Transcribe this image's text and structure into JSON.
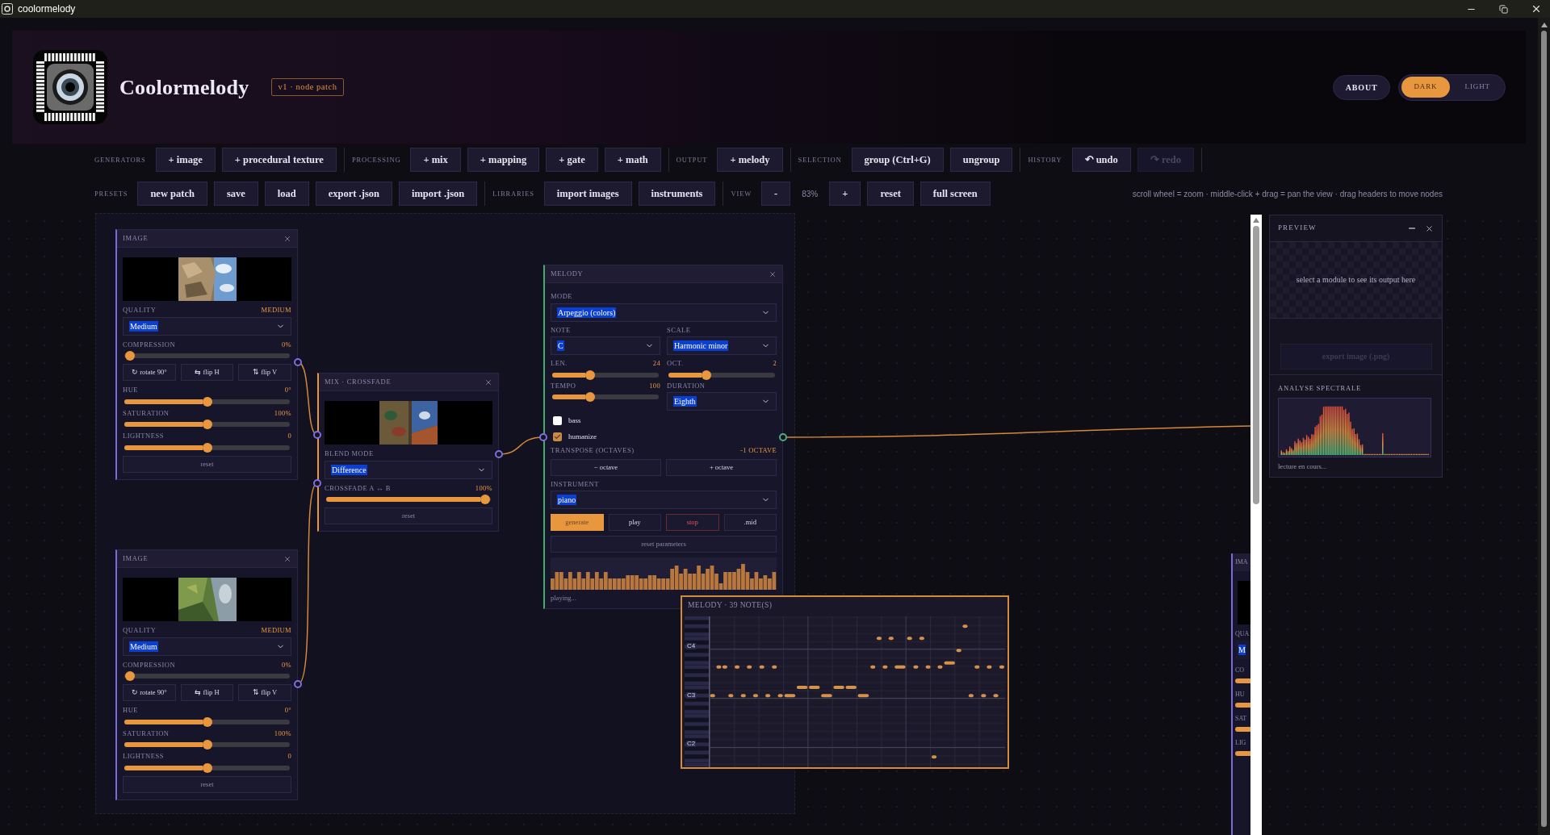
{
  "window": {
    "title": "coolormelody"
  },
  "header": {
    "title": "Coolormelody",
    "badge": "v1 · node patch",
    "about": "ABOUT",
    "theme": [
      {
        "label": "DARK",
        "selected": true
      },
      {
        "label": "LIGHT",
        "selected": false
      }
    ]
  },
  "toolbar": [
    {
      "groups": [
        {
          "label": "GENERATORS",
          "items": [
            {
              "kind": "button",
              "label": "+ image"
            },
            {
              "kind": "button",
              "label": "+ procedural texture"
            }
          ]
        },
        {
          "label": "PROCESSING",
          "items": [
            {
              "kind": "button",
              "label": "+ mix"
            },
            {
              "kind": "button",
              "label": "+ mapping"
            },
            {
              "kind": "button",
              "label": "+ gate"
            },
            {
              "kind": "button",
              "label": "+ math"
            }
          ]
        },
        {
          "label": "OUTPUT",
          "items": [
            {
              "kind": "button",
              "label": "+ melody"
            }
          ]
        },
        {
          "label": "SELECTION",
          "items": [
            {
              "kind": "button",
              "label": "group (Ctrl+G)"
            },
            {
              "kind": "button",
              "label": "ungroup"
            }
          ]
        },
        {
          "label": "HISTORY",
          "items": [
            {
              "kind": "button",
              "label": "↶ undo",
              "disabled": false
            },
            {
              "kind": "button",
              "label": "↷ redo",
              "disabled": true
            }
          ]
        }
      ]
    },
    {
      "groups": [
        {
          "label": "PRESETS",
          "items": [
            {
              "kind": "button",
              "label": "new patch"
            },
            {
              "kind": "button",
              "label": "save"
            },
            {
              "kind": "button",
              "label": "load"
            },
            {
              "kind": "button",
              "label": "export .json"
            },
            {
              "kind": "button",
              "label": "import .json"
            }
          ]
        },
        {
          "label": "LIBRARIES",
          "items": [
            {
              "kind": "button",
              "label": "import images"
            },
            {
              "kind": "button",
              "label": "instruments"
            }
          ]
        },
        {
          "label": "VIEW",
          "items": [
            {
              "kind": "button",
              "label": "-"
            },
            {
              "kind": "reading",
              "label": "83%"
            },
            {
              "kind": "button",
              "label": "+"
            },
            {
              "kind": "button",
              "label": "reset"
            },
            {
              "kind": "button",
              "label": "full screen"
            }
          ]
        }
      ],
      "hint": "scroll wheel = zoom · middle-click + drag = pan the view · drag headers to move nodes"
    }
  ],
  "canvas": {
    "image_nodes": [
      {
        "title": "IMAGE",
        "controls": [
          {
            "kind": "preview"
          },
          {
            "kind": "select",
            "label": "QUALITY",
            "reading": "MEDIUM",
            "value": "Medium"
          },
          {
            "kind": "slider",
            "label": "COMPRESSION",
            "reading": "0%",
            "level": 0
          },
          {
            "kind": "buttons",
            "items": [
              {
                "label": "↻ rotate 90°",
                "kind": "plain"
              },
              {
                "label": "⇆ flip H",
                "kind": "plain"
              },
              {
                "label": "⇅ flip V",
                "kind": "plain"
              }
            ]
          },
          {
            "kind": "slider",
            "label": "HUE",
            "reading": "0°",
            "level": 0.5
          },
          {
            "kind": "slider",
            "label": "SATURATION",
            "reading": "100%",
            "level": 0.5
          },
          {
            "kind": "slider",
            "label": "LIGHTNESS",
            "reading": "0",
            "level": 0.5
          },
          {
            "kind": "button",
            "label": "reset"
          }
        ]
      },
      {
        "title": "IMAGE",
        "controls": [
          {
            "kind": "preview"
          },
          {
            "kind": "select",
            "label": "QUALITY",
            "reading": "MEDIUM",
            "value": "Medium"
          },
          {
            "kind": "slider",
            "label": "COMPRESSION",
            "reading": "0%",
            "level": 0
          },
          {
            "kind": "buttons",
            "items": [
              {
                "label": "↻ rotate 90°",
                "kind": "plain"
              },
              {
                "label": "⇆ flip H",
                "kind": "plain"
              },
              {
                "label": "⇅ flip V",
                "kind": "plain"
              }
            ]
          },
          {
            "kind": "slider",
            "label": "HUE",
            "reading": "0°",
            "level": 0.5
          },
          {
            "kind": "slider",
            "label": "SATURATION",
            "reading": "100%",
            "level": 0.5
          },
          {
            "kind": "slider",
            "label": "LIGHTNESS",
            "reading": "0",
            "level": 0.5
          },
          {
            "kind": "button",
            "label": "reset"
          }
        ]
      }
    ],
    "mix_node": {
      "title": "MIX · CROSSFADE",
      "controls": [
        {
          "kind": "preview"
        },
        {
          "kind": "select",
          "label": "BLEND MODE",
          "value": "Difference"
        },
        {
          "kind": "slider",
          "label": "CROSSFADE A ↔ B",
          "reading": "100%",
          "level": 1
        },
        {
          "kind": "button",
          "label": "reset"
        }
      ]
    },
    "melody_node": {
      "title": "MELODY",
      "controls": [
        {
          "kind": "select",
          "label": "MODE",
          "value": "Arpeggio (colors)"
        },
        {
          "kind": "row",
          "items": [
            {
              "kind": "select",
              "label": "NOTE",
              "value": "C"
            },
            {
              "kind": "select",
              "label": "SCALE",
              "value": "Harmonic minor"
            }
          ]
        },
        {
          "kind": "row",
          "items": [
            {
              "kind": "slider",
              "label": "LEN.",
              "reading": "24",
              "level": 0.34
            },
            {
              "kind": "slider",
              "label": "OCT.",
              "reading": "2",
              "level": 0.34
            }
          ]
        },
        {
          "kind": "row",
          "items": [
            {
              "kind": "slider",
              "label": "TEMPO",
              "reading": "100",
              "level": 0.34
            },
            {
              "kind": "select",
              "label": "DURATION",
              "value": "Eighth"
            }
          ]
        },
        {
          "kind": "checkbox",
          "label": "bass",
          "checked": false
        },
        {
          "kind": "checkbox",
          "label": "humanize",
          "checked": true
        },
        {
          "kind": "label",
          "label": "TRANSPOSE (OCTAVES)",
          "reading": "-1 OCTAVE"
        },
        {
          "kind": "buttons",
          "items": [
            {
              "label": "− octave",
              "kind": "plain"
            },
            {
              "label": "+ octave",
              "kind": "plain"
            }
          ]
        },
        {
          "kind": "select",
          "label": "INSTRUMENT",
          "value": "piano"
        },
        {
          "kind": "buttons",
          "items": [
            {
              "label": "generate",
              "kind": "primary"
            },
            {
              "label": "play",
              "kind": "plain"
            },
            {
              "label": "stop",
              "kind": "danger"
            },
            {
              "label": ".mid",
              "kind": "plain"
            }
          ]
        },
        {
          "kind": "button",
          "label": "reset parameters"
        },
        {
          "kind": "bars"
        },
        {
          "kind": "status",
          "label": "playing..."
        }
      ]
    },
    "piano_roll": {
      "title": "MELODY · 39 NOTE(S)",
      "octave_labels": [
        "C4",
        "C3",
        "C2"
      ]
    },
    "clipped_node": {
      "title": "IMA",
      "labels": [
        "QUA",
        "CO",
        "HU",
        "SAT",
        "LIG"
      ],
      "select_value": "M"
    }
  },
  "preview": {
    "title": "PREVIEW",
    "message": "select a module to see its output here",
    "export": {
      "label": "export image (.png)",
      "disabled": true
    },
    "analysis_title": "ANALYSE SPECTRALE",
    "status": "lecture en cours..."
  }
}
